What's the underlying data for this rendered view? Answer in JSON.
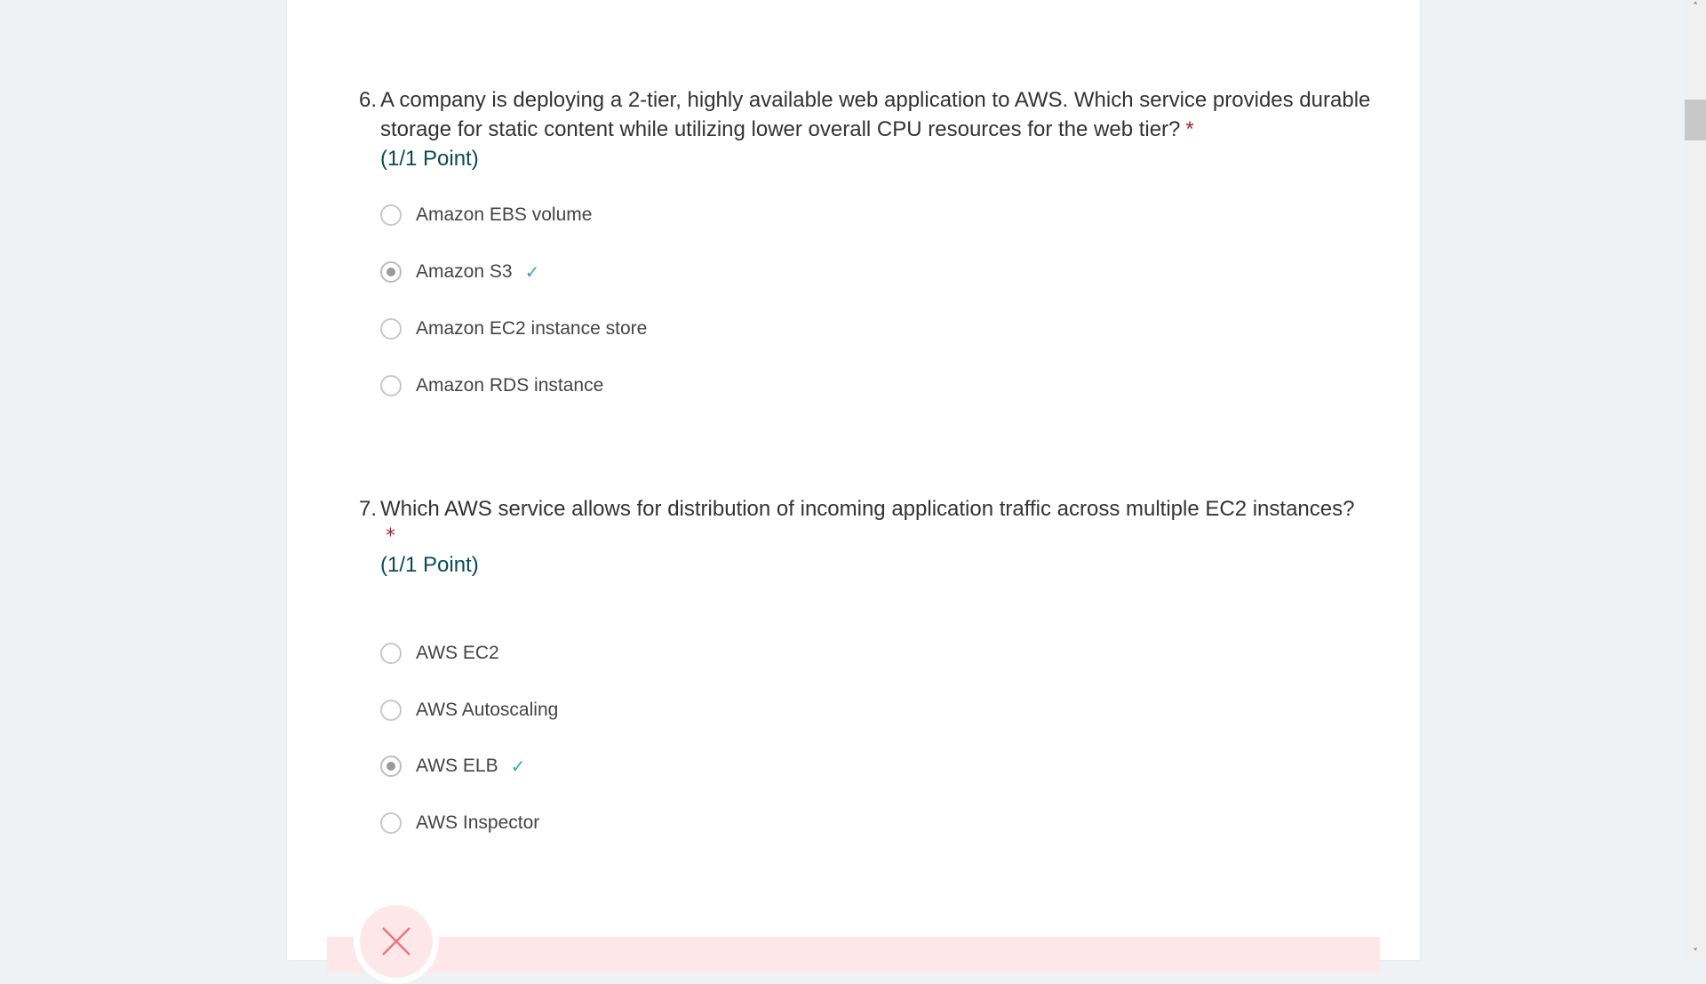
{
  "questions": [
    {
      "number": "6.",
      "text": "A company is deploying a 2-tier, highly available web application to AWS. Which service provides durable storage for static content while utilizing lower overall CPU resources for the web tier?",
      "required_marker": "*",
      "points": "(1/1 Point)",
      "options": [
        {
          "label": "Amazon EBS volume",
          "selected": false,
          "correct": false
        },
        {
          "label": "Amazon S3",
          "selected": true,
          "correct": true
        },
        {
          "label": "Amazon EC2 instance store",
          "selected": false,
          "correct": false
        },
        {
          "label": "Amazon RDS instance",
          "selected": false,
          "correct": false
        }
      ]
    },
    {
      "number": "7.",
      "text": "Which AWS service allows for distribution of incoming application traffic across multiple EC2 instances?",
      "required_marker": "*",
      "points": "(1/1 Point)",
      "options": [
        {
          "label": "AWS EC2",
          "selected": false,
          "correct": false
        },
        {
          "label": "AWS Autoscaling",
          "selected": false,
          "correct": false
        },
        {
          "label": "AWS ELB",
          "selected": true,
          "correct": true
        },
        {
          "label": "AWS Inspector",
          "selected": false,
          "correct": false
        }
      ]
    }
  ],
  "icons": {
    "correct": "checkmark-icon",
    "incorrect": "x-icon",
    "scroll_up": "chevron-up-icon",
    "scroll_down": "chevron-down-icon"
  },
  "colors": {
    "background": "#eef2f4",
    "card": "#ffffff",
    "required": "#a4262c",
    "points": "#0b4a57",
    "check": "#3aa8a8",
    "incorrect_bg": "#fde7e9",
    "incorrect_icon": "#e8777f"
  }
}
